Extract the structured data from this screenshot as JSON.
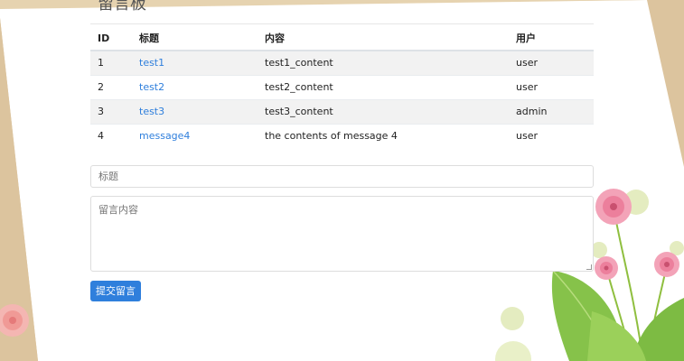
{
  "page": {
    "title": "留言板"
  },
  "table": {
    "headers": {
      "id": "ID",
      "title": "标题",
      "content": "内容",
      "user": "用户"
    },
    "rows": [
      {
        "id": "1",
        "title": "test1",
        "content": "test1_content",
        "user": "user"
      },
      {
        "id": "2",
        "title": "test2",
        "content": "test2_content",
        "user": "user"
      },
      {
        "id": "3",
        "title": "test3",
        "content": "test3_content",
        "user": "admin"
      },
      {
        "id": "4",
        "title": "message4",
        "content": "the contents of message 4",
        "user": "user"
      }
    ]
  },
  "form": {
    "title_placeholder": "标题",
    "content_placeholder": "留言内容",
    "submit_label": "提交留言"
  },
  "colors": {
    "accent": "#2f7fdc",
    "link": "#2f7fdc",
    "stripe": "#f2f2f2",
    "background": "#dcc49e"
  }
}
